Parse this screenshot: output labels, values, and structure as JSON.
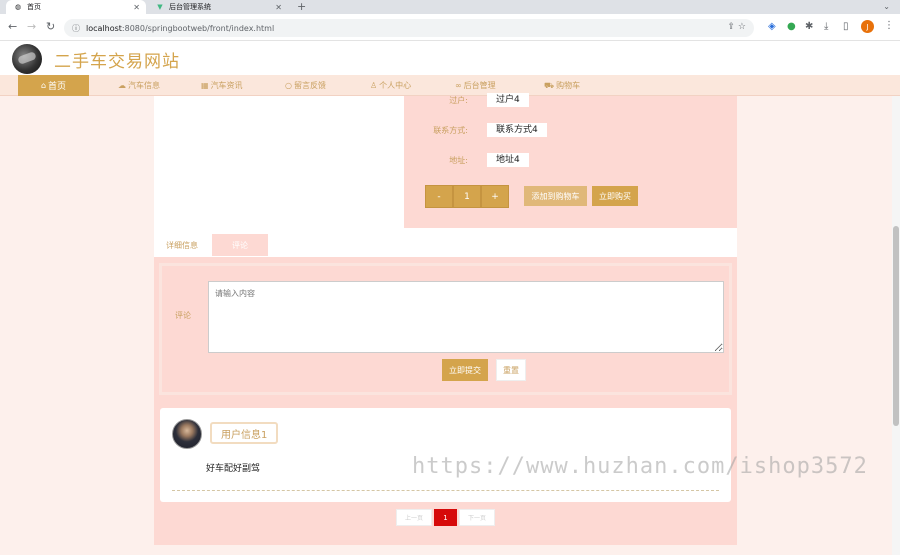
{
  "browser": {
    "tabs": [
      {
        "title": "首页",
        "active": true
      },
      {
        "title": "后台管理系统",
        "active": false
      }
    ],
    "url_host": "localhost",
    "url_path": ":8080/springbootweb/front/index.html",
    "profile_initial": "J"
  },
  "site": {
    "title": "二手车交易网站",
    "nav": [
      {
        "label": "首页",
        "icon": "home-icon"
      },
      {
        "label": "汽车信息",
        "icon": "cloud-icon"
      },
      {
        "label": "汽车资讯",
        "icon": "news-icon"
      },
      {
        "label": "留言反馈",
        "icon": "chat-icon"
      },
      {
        "label": "个人中心",
        "icon": "user-icon"
      },
      {
        "label": "后台管理",
        "icon": "link-icon"
      },
      {
        "label": "购物车",
        "icon": "cart-icon"
      }
    ]
  },
  "product": {
    "specs": [
      {
        "label": "过户:",
        "value": "过户4"
      },
      {
        "label": "联系方式:",
        "value": "联系方式4"
      },
      {
        "label": "地址:",
        "value": "地址4"
      }
    ],
    "quantity": {
      "minus": "-",
      "value": "1",
      "plus": "+"
    },
    "add_to_cart": "添加到购物车",
    "buy_now": "立即购买"
  },
  "tabs": {
    "detail": "详细信息",
    "comment": "评论"
  },
  "comment_form": {
    "label": "评论",
    "placeholder": "请输入内容",
    "submit": "立即提交",
    "reset": "重置"
  },
  "comments": [
    {
      "user": "用户信息1",
      "text": "好车配好副驾"
    }
  ],
  "pagination": {
    "prev": "上一页",
    "current": "1",
    "next": "下一页"
  },
  "watermark": "https://www.huzhan.com/ishop3572",
  "colors": {
    "accent": "#d4a44c",
    "panel_pink": "#fdd9d3",
    "active_page": "#d60a0a"
  }
}
